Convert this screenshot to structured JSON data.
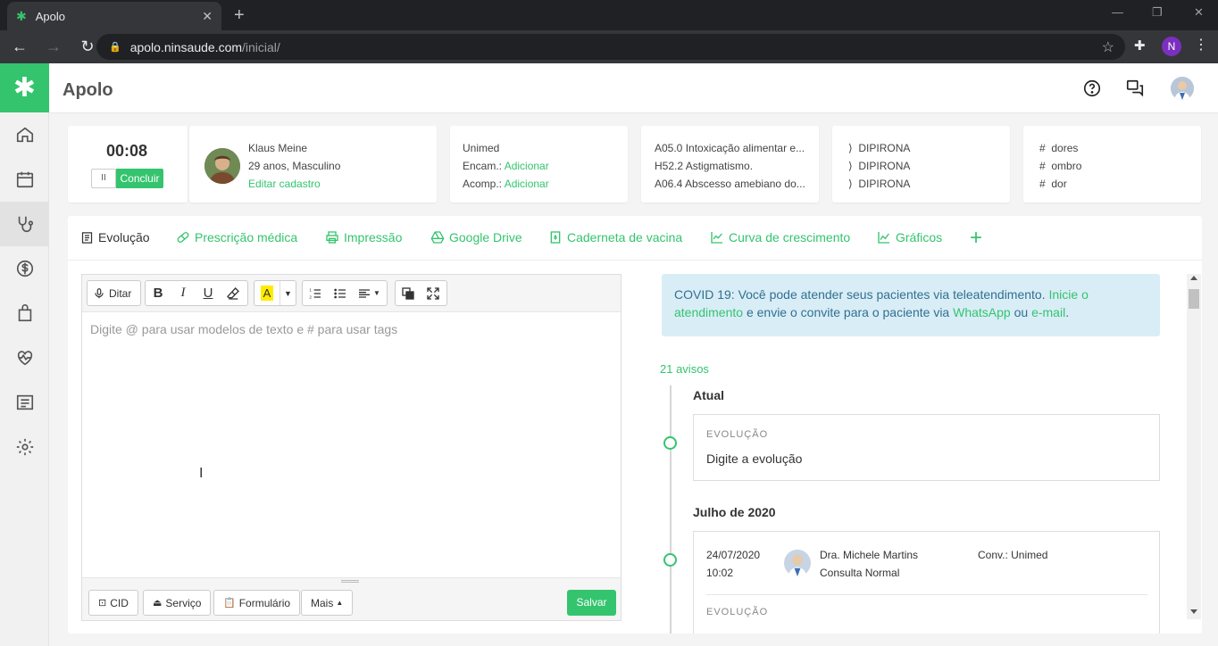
{
  "browser": {
    "tab_title": "Apolo",
    "url_domain": "apolo.ninsaude.com",
    "url_path": "/inicial/",
    "profile_initial": "N"
  },
  "app": {
    "title": "Apolo",
    "accent_color": "#34c46e"
  },
  "sidebar": {
    "items": [
      {
        "icon": "home-icon"
      },
      {
        "icon": "calendar-icon"
      },
      {
        "icon": "stethoscope-icon"
      },
      {
        "icon": "dollar-icon"
      },
      {
        "icon": "shopping-bag-icon"
      },
      {
        "icon": "heartbeat-icon"
      },
      {
        "icon": "report-icon"
      },
      {
        "icon": "gear-icon"
      }
    ]
  },
  "timer": {
    "value": "00:08",
    "pause_label": "II",
    "finish_label": "Concluir"
  },
  "patient": {
    "name": "Klaus Meine",
    "details": "29 anos, Masculino",
    "edit_label": "Editar cadastro"
  },
  "insurance": {
    "name": "Unimed",
    "encam_label": "Encam.:",
    "encam_action": "Adicionar",
    "acomp_label": "Acomp.:",
    "acomp_action": "Adicionar"
  },
  "diagnoses": [
    "A05.0 Intoxicação alimentar e...",
    "H52.2 Astigmatismo.",
    "A06.4 Abscesso amebiano do..."
  ],
  "medications": [
    "DIPIRONA",
    "DIPIRONA",
    "DIPIRONA"
  ],
  "tags": [
    "dores",
    "ombro",
    "dor"
  ],
  "tabs": [
    {
      "label": "Evolução"
    },
    {
      "label": "Prescrição médica"
    },
    {
      "label": "Impressão"
    },
    {
      "label": "Google Drive"
    },
    {
      "label": "Caderneta de vacina"
    },
    {
      "label": "Curva de crescimento"
    },
    {
      "label": "Gráficos"
    }
  ],
  "editor": {
    "dictate_label": "Ditar",
    "placeholder": "Digite @ para usar modelos de texto e # para usar tags",
    "footer": {
      "cid_label": "CID",
      "service_label": "Serviço",
      "form_label": "Formulário",
      "more_label": "Mais",
      "save_label": "Salvar"
    }
  },
  "covid": {
    "text1": "COVID 19: Você pode atender seus pacientes via teleatendimento.",
    "link1": "Inicie o atendimento",
    "text2": "e envie o convite para o paciente via",
    "link2": "WhatsApp",
    "text3": "ou",
    "link3": "e-mail",
    "text4": "."
  },
  "timeline": {
    "avisos": "21 avisos",
    "current_heading": "Atual",
    "current_card": {
      "label": "EVOLUÇÃO",
      "text": "Digite a evolução"
    },
    "month_heading": "Julho de 2020",
    "entry": {
      "date": "24/07/2020",
      "time": "10:02",
      "doctor": "Dra. Michele Martins",
      "type": "Consulta Normal",
      "insurance": "Conv.: Unimed",
      "label": "EVOLUÇÃO"
    }
  }
}
